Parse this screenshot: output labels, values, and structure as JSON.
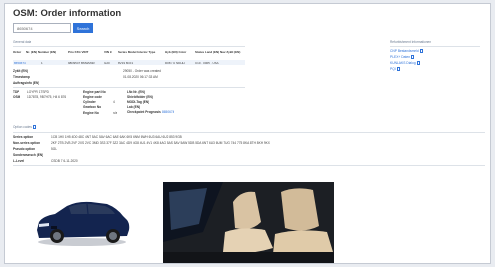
{
  "app": {
    "title": "OSM: Order information"
  },
  "search": {
    "value": "8650674",
    "button": "Search"
  },
  "general": {
    "label": "General data",
    "columns": [
      "Order",
      "Nr. (EN) Number (EN)",
      "Prio FZG VINT",
      "VIN 9",
      "Series Model Interior Type",
      "Hyb (EN) Color",
      "Status Land (EN) Nav Zyklt (EN)"
    ],
    "row": [
      "8650674 01",
      "1",
      "98D9547 BMWM4R",
      "G20",
      "8V19 8CF1",
      "D08 / U NDHH",
      "C10 · 0005 · USA"
    ]
  },
  "fields": {
    "zyklt": {
      "label": "Zyklt (EN)",
      "value": ""
    },
    "timestamp": {
      "label": "Timestamp",
      "value": ""
    },
    "auftragsinfo": {
      "label": "Auftragsinfo (EN)",
      "value": ""
    },
    "order_status": "29050 - Order was created",
    "order_date": "01.08.2020 06:17:33 AM",
    "tdp": {
      "label": "TDP",
      "value": "LOYPR 1TSPD"
    },
    "osm": {
      "label": "OSM",
      "value": "1D7878, 9B7H75, H4 6 876"
    },
    "engine_part_no": {
      "label": "Engine part No",
      "value": ""
    },
    "engine_code": {
      "label": "Engine code",
      "value": ""
    },
    "cylinder": {
      "label": "Cylinder",
      "value": "4"
    },
    "gearbox_no": {
      "label": "Gearbox No",
      "value": ""
    },
    "engine_no": {
      "label": "Engine No",
      "value": "n/a"
    },
    "lnr_nr": {
      "label": "LNr.Nr. (EN)",
      "value": ""
    },
    "shield": {
      "label": "Shieldfolder (EN)",
      "value": ""
    },
    "modi_tag": {
      "label": "MODI-Tag (EN)",
      "value": ""
    },
    "lab_en": {
      "label": "Lab (EN)",
      "value": ""
    },
    "checkpoint": {
      "label": "Checkpoint Prognosis",
      "value": "8650674"
    }
  },
  "external": {
    "label": "Refurbishment Informationen",
    "links": [
      "CNP Bestandsmeld",
      "PLEX+ Daten",
      "KUNLAKS Dialog",
      "PQI"
    ]
  },
  "options": {
    "label": "Option codes",
    "series": {
      "label": "Series option",
      "value": "1CB 1H0 1H5 4D0 48C 4NT 5AC 5AV 6AC 6AE 6AK 6K5 6NM 6WH 6U3 6AU 6U2 853 9GB"
    },
    "non_series": {
      "label": "Non-series option",
      "value": "2KF 2TB 2VB 2VF 2XS 2VC 3MD 3S3 37F 3Z2 3AC 4D9 4G8 4U1 4V1 4K8 4AG 5AS 5AV 5AW 5DB 5DA 6NT 6U3 6UM 7UG 744 775 8KA 8TH 8KH 9KX"
    },
    "pseudo": {
      "label": "Pseudo option",
      "value": "5GL"
    },
    "sonderwunsch": {
      "label": "Sonderwunsch (EN)",
      "value": ""
    },
    "l_level": {
      "label": "L-Level",
      "value": "CSDB 7 6-11-2020"
    }
  },
  "images": {
    "exterior": "car-exterior-photo",
    "interior": "car-interior-photo"
  },
  "colors": {
    "accent": "#2f73d9",
    "car_body": "#13244f",
    "seat": "#d9c3a3"
  }
}
